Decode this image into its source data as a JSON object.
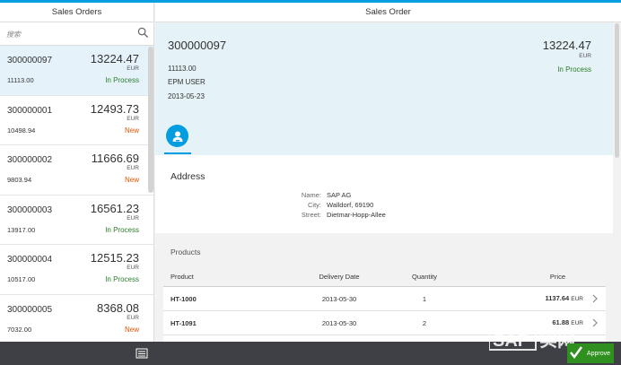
{
  "master": {
    "title": "Sales Orders",
    "search_placeholder": "搜索",
    "orders": [
      {
        "id": "300000097",
        "amount": "13224.47",
        "currency": "EUR",
        "net": "11113.00",
        "status": "In Process",
        "status_color": "#2b7d2b"
      },
      {
        "id": "300000001",
        "amount": "12493.73",
        "currency": "EUR",
        "net": "10498.94",
        "status": "New",
        "status_color": "#e35500"
      },
      {
        "id": "300000002",
        "amount": "11666.69",
        "currency": "EUR",
        "net": "9803.94",
        "status": "New",
        "status_color": "#e35500"
      },
      {
        "id": "300000003",
        "amount": "16561.23",
        "currency": "EUR",
        "net": "13917.00",
        "status": "In Process",
        "status_color": "#2b7d2b"
      },
      {
        "id": "300000004",
        "amount": "12515.23",
        "currency": "EUR",
        "net": "10517.00",
        "status": "In Process",
        "status_color": "#2b7d2b"
      },
      {
        "id": "300000005",
        "amount": "8368.08",
        "currency": "EUR",
        "net": "7032.00",
        "status": "New",
        "status_color": "#e35500"
      }
    ]
  },
  "detail": {
    "title": "Sales Order",
    "header": {
      "id": "300000097",
      "net": "11113.00",
      "user": "EPM USER",
      "date": "2013-05-23",
      "amount": "13224.47",
      "currency": "EUR",
      "status": "In Process"
    },
    "tab_icon": "person-icon",
    "address": {
      "title": "Address",
      "name_label": "Name:",
      "name": "SAP AG",
      "city_label": "City:",
      "city": "Walldorf, 69190",
      "street_label": "Street:",
      "street": "Dietmar-Hopp-Allee"
    },
    "products": {
      "title": "Products",
      "columns": {
        "product": "Product",
        "date": "Delivery Date",
        "qty": "Quantity",
        "price": "Price"
      },
      "rows": [
        {
          "product": "HT-1000",
          "date": "2013-05-30",
          "qty": "1",
          "price": "1137.64",
          "currency": "EUR"
        },
        {
          "product": "HT-1091",
          "date": "2013-05-30",
          "qty": "2",
          "price": "61.88",
          "currency": "EUR"
        }
      ]
    }
  },
  "footer": {
    "approve_label": "Approve",
    "watermark": "SAP 实网"
  },
  "colors": {
    "accent": "#009de0",
    "positive": "#2b7d2b",
    "new": "#e35500",
    "footer": "#3f4045"
  }
}
